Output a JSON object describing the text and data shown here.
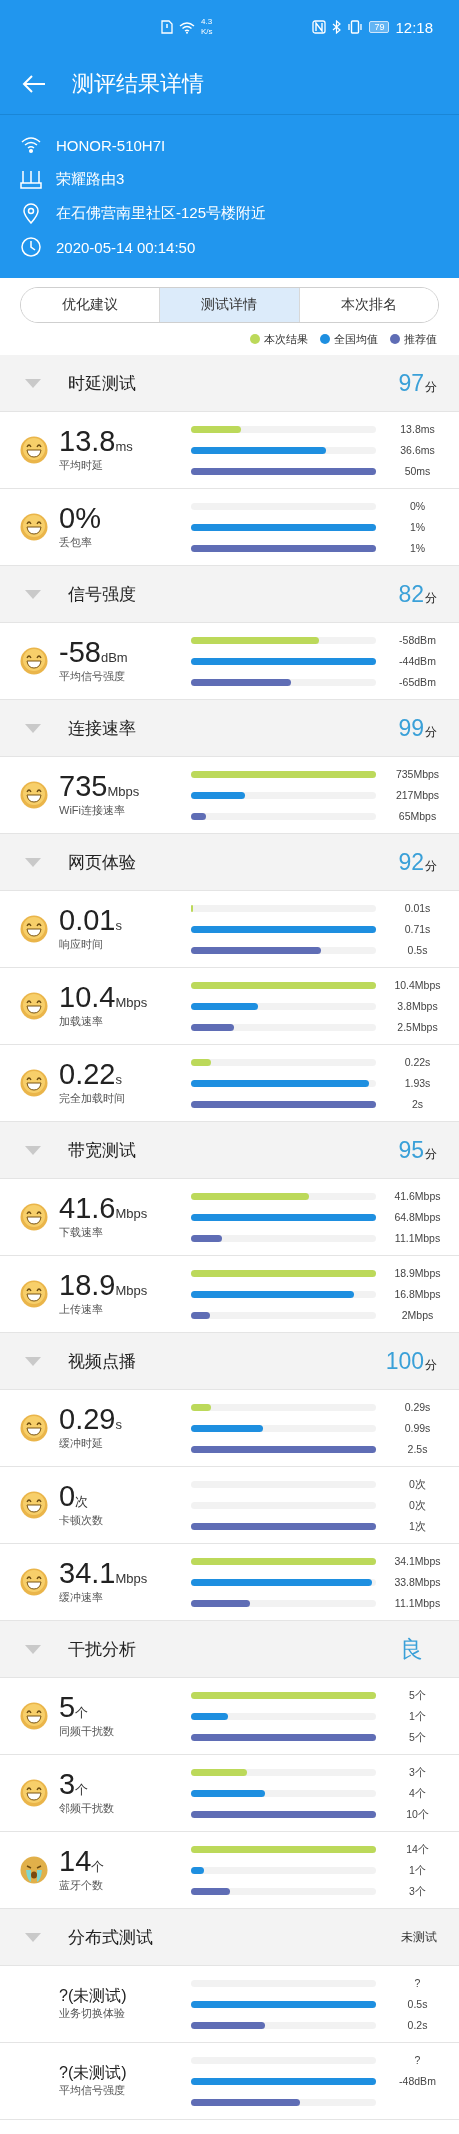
{
  "status_bar": {
    "speed_value": "4.3",
    "speed_unit": "K/s",
    "battery": "79",
    "time": "12:18"
  },
  "header": {
    "title": "测评结果详情"
  },
  "info": [
    {
      "kind": "wifi",
      "text": "HONOR-510H7I"
    },
    {
      "kind": "router",
      "text": "荣耀路由3"
    },
    {
      "kind": "location",
      "text": "在石佛营南里社区-125号楼附近"
    },
    {
      "kind": "time",
      "text": "2020-05-14 00:14:50"
    }
  ],
  "tabs": [
    {
      "label": "优化建议",
      "selected": false
    },
    {
      "label": "测试详情",
      "selected": true
    },
    {
      "label": "本次排名",
      "selected": false
    }
  ],
  "legend": [
    {
      "label": "本次结果",
      "color": "#bcd95a"
    },
    {
      "label": "全国均值",
      "color": "#1e8fe0"
    },
    {
      "label": "推荐值",
      "color": "#5f6db5"
    }
  ],
  "sections": [
    {
      "title": "时延测试",
      "expanded": true,
      "score": {
        "kind": "points",
        "value": "97",
        "unit": "分"
      },
      "metrics": [
        {
          "kind": "happy",
          "value": "13.8",
          "unit": "ms",
          "label": "平均时延",
          "bars": [
            {
              "level": 0.27,
              "reading": "13.8ms"
            },
            {
              "level": 0.73,
              "reading": "36.6ms"
            },
            {
              "level": 1,
              "reading": "50ms"
            }
          ]
        },
        {
          "kind": "happy",
          "value": "0%",
          "label": "丢包率",
          "bars": [
            {
              "level": 0,
              "reading": "0%"
            },
            {
              "level": 1,
              "reading": "1%"
            },
            {
              "level": 1,
              "reading": "1%"
            }
          ]
        }
      ]
    },
    {
      "title": "信号强度",
      "expanded": true,
      "score": {
        "kind": "points",
        "value": "82",
        "unit": "分"
      },
      "metrics": [
        {
          "kind": "happy",
          "value": "-58",
          "unit": "dBm",
          "label": "平均信号强度",
          "bars": [
            {
              "level": 0.69,
              "reading": "-58dBm"
            },
            {
              "level": 1,
              "reading": "-44dBm"
            },
            {
              "level": 0.54,
              "reading": "-65dBm"
            }
          ]
        }
      ]
    },
    {
      "title": "连接速率",
      "expanded": true,
      "score": {
        "kind": "points",
        "value": "99",
        "unit": "分"
      },
      "metrics": [
        {
          "kind": "happy",
          "value": "735",
          "unit": "Mbps",
          "label": "WiFi连接速率",
          "bars": [
            {
              "level": 1,
              "reading": "735Mbps"
            },
            {
              "level": 0.29,
              "reading": "217Mbps"
            },
            {
              "level": 0.08,
              "reading": "65Mbps"
            }
          ]
        }
      ]
    },
    {
      "title": "网页体验",
      "expanded": true,
      "score": {
        "kind": "points",
        "value": "92",
        "unit": "分"
      },
      "metrics": [
        {
          "kind": "happy",
          "value": "0.01",
          "unit": "s",
          "label": "响应时间",
          "bars": [
            {
              "level": 0.01,
              "reading": "0.01s"
            },
            {
              "level": 1,
              "reading": "0.71s"
            },
            {
              "level": 0.7,
              "reading": "0.5s"
            }
          ]
        },
        {
          "kind": "happy",
          "value": "10.4",
          "unit": "Mbps",
          "label": "加载速率",
          "bars": [
            {
              "level": 1,
              "reading": "10.4Mbps"
            },
            {
              "level": 0.36,
              "reading": "3.8Mbps"
            },
            {
              "level": 0.23,
              "reading": "2.5Mbps"
            }
          ]
        },
        {
          "kind": "happy",
          "value": "0.22",
          "unit": "s",
          "label": "完全加载时间",
          "bars": [
            {
              "level": 0.11,
              "reading": "0.22s"
            },
            {
              "level": 0.96,
              "reading": "1.93s"
            },
            {
              "level": 1,
              "reading": "2s"
            }
          ]
        }
      ]
    },
    {
      "title": "带宽测试",
      "expanded": true,
      "score": {
        "kind": "points",
        "value": "95",
        "unit": "分"
      },
      "metrics": [
        {
          "kind": "happy",
          "value": "41.6",
          "unit": "Mbps",
          "label": "下载速率",
          "bars": [
            {
              "level": 0.64,
              "reading": "41.6Mbps"
            },
            {
              "level": 1,
              "reading": "64.8Mbps"
            },
            {
              "level": 0.17,
              "reading": "11.1Mbps"
            }
          ]
        },
        {
          "kind": "happy",
          "value": "18.9",
          "unit": "Mbps",
          "label": "上传速率",
          "bars": [
            {
              "level": 1,
              "reading": "18.9Mbps"
            },
            {
              "level": 0.88,
              "reading": "16.8Mbps"
            },
            {
              "level": 0.1,
              "reading": "2Mbps"
            }
          ]
        }
      ]
    },
    {
      "title": "视频点播",
      "expanded": true,
      "score": {
        "kind": "points",
        "value": "100",
        "unit": "分"
      },
      "metrics": [
        {
          "kind": "happy",
          "value": "0.29",
          "unit": "s",
          "label": "缓冲时延",
          "bars": [
            {
              "level": 0.11,
              "reading": "0.29s"
            },
            {
              "level": 0.39,
              "reading": "0.99s"
            },
            {
              "level": 1,
              "reading": "2.5s"
            }
          ]
        },
        {
          "kind": "happy",
          "value": "0",
          "unit": "次",
          "label": "卡顿次数",
          "bars": [
            {
              "level": 0,
              "reading": "0次"
            },
            {
              "level": 0,
              "reading": "0次"
            },
            {
              "level": 1,
              "reading": "1次"
            }
          ]
        },
        {
          "kind": "happy",
          "value": "34.1",
          "unit": "Mbps",
          "label": "缓冲速率",
          "bars": [
            {
              "level": 1,
              "reading": "34.1Mbps"
            },
            {
              "level": 0.98,
              "reading": "33.8Mbps"
            },
            {
              "level": 0.32,
              "reading": "11.1Mbps"
            }
          ]
        }
      ]
    },
    {
      "title": "干扰分析",
      "expanded": true,
      "score": {
        "kind": "grade",
        "value": "良"
      },
      "metrics": [
        {
          "kind": "happy",
          "value": "5",
          "unit": "个",
          "label": "同频干扰数",
          "bars": [
            {
              "level": 1,
              "reading": "5个"
            },
            {
              "level": 0.2,
              "reading": "1个"
            },
            {
              "level": 1,
              "reading": "5个"
            }
          ]
        },
        {
          "kind": "happy",
          "value": "3",
          "unit": "个",
          "label": "邻频干扰数",
          "bars": [
            {
              "level": 0.3,
              "reading": "3个"
            },
            {
              "level": 0.4,
              "reading": "4个"
            },
            {
              "level": 1,
              "reading": "10个"
            }
          ]
        },
        {
          "kind": "crying",
          "value": "14",
          "unit": "个",
          "label": "蓝牙个数",
          "bars": [
            {
              "level": 1,
              "reading": "14个"
            },
            {
              "level": 0.07,
              "reading": "1个"
            },
            {
              "level": 0.21,
              "reading": "3个"
            }
          ]
        }
      ]
    },
    {
      "title": "分布式测试",
      "expanded": true,
      "score": {
        "kind": "note",
        "value": "未测试"
      },
      "metrics": [
        {
          "kind": "untested",
          "value": "?(未测试)",
          "label": "业务切换体验",
          "bars": [
            {
              "level": 0,
              "reading": "?"
            },
            {
              "level": 1,
              "reading": "0.5s"
            },
            {
              "level": 0.4,
              "reading": "0.2s"
            }
          ]
        },
        {
          "kind": "untested",
          "value": "?(未测试)",
          "label": "平均信号强度",
          "bars": [
            {
              "level": 0,
              "reading": "?"
            },
            {
              "level": 1,
              "reading": "-48dBm"
            },
            {
              "level": 0.59
            }
          ]
        }
      ]
    }
  ]
}
